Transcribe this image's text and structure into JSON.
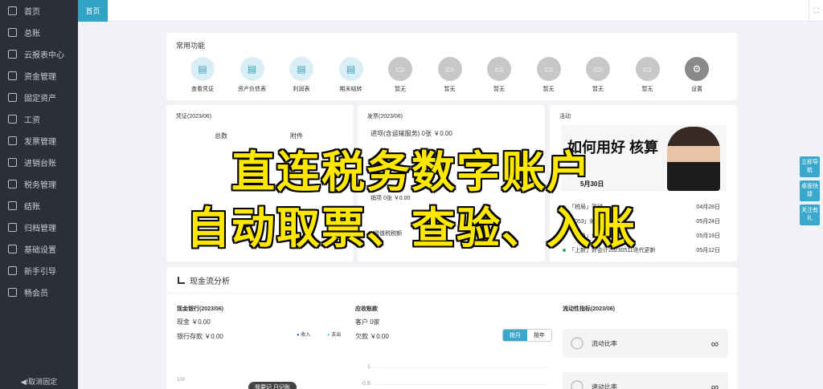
{
  "sidebar": {
    "items": [
      {
        "label": "首页",
        "icon": "home-icon"
      },
      {
        "label": "总账",
        "icon": "ledger-icon"
      },
      {
        "label": "云报表中心",
        "icon": "report-icon"
      },
      {
        "label": "资金管理",
        "icon": "fund-icon"
      },
      {
        "label": "固定资产",
        "icon": "asset-icon"
      },
      {
        "label": "工资",
        "icon": "salary-icon"
      },
      {
        "label": "发票管理",
        "icon": "invoice-icon"
      },
      {
        "label": "进销台账",
        "icon": "inventory-icon"
      },
      {
        "label": "税务管理",
        "icon": "tax-icon"
      },
      {
        "label": "结账",
        "icon": "close-books-icon"
      },
      {
        "label": "归档管理",
        "icon": "archive-icon"
      },
      {
        "label": "基础设置",
        "icon": "settings-icon"
      },
      {
        "label": "新手引导",
        "icon": "guide-icon"
      },
      {
        "label": "畅会员",
        "icon": "vip-icon"
      }
    ],
    "unfix_label": "◀!取消固定"
  },
  "topbar": {
    "home_tab": "首页",
    "fullscreen": "⛶"
  },
  "common": {
    "title": "常用功能",
    "items": [
      {
        "label": "查看凭证",
        "state": "active"
      },
      {
        "label": "资产负债表",
        "state": "active"
      },
      {
        "label": "利润表",
        "state": "active"
      },
      {
        "label": "期末结转",
        "state": "active"
      },
      {
        "label": "暂无",
        "state": "disabled"
      },
      {
        "label": "暂无",
        "state": "disabled"
      },
      {
        "label": "暂无",
        "state": "disabled"
      },
      {
        "label": "暂无",
        "state": "disabled"
      },
      {
        "label": "暂无",
        "state": "disabled"
      },
      {
        "label": "暂无",
        "state": "disabled"
      },
      {
        "label": "设置",
        "state": "settings"
      }
    ]
  },
  "voucher": {
    "title": "凭证(2023/06)",
    "total_label": "总数",
    "attach_label": "附件"
  },
  "invoice": {
    "title": "发票(2023/06)",
    "input_line": "进项(含运输服务) 0张 ￥0.00",
    "sales_line": "销项   0张   ￥0.00",
    "vat_label": "增值税税额",
    "amount": "0.00"
  },
  "activity": {
    "title": "活动",
    "banner_title": "如何用好 核算",
    "banner_date": "5月30日",
    "news": [
      {
        "text": "「税局」答疑",
        "date": "04月28日"
      },
      {
        "text": "「053」如何用",
        "date": "05月24日"
      },
      {
        "text": "「用户」如何用友",
        "date": "05月19日"
      },
      {
        "text": "「上新」好会计20230511迭代更新",
        "date": "05月12日"
      }
    ]
  },
  "float_buttons": [
    "立即导航",
    "桌面快捷",
    "关注有礼"
  ],
  "overlay": {
    "line1": "直连税务数字账户",
    "line2": "自动取票、查验、入账"
  },
  "cashflow": {
    "title": "现金流分析",
    "bank": {
      "title": "现金银行(2023/06)",
      "cash": "现金  ￥0.00",
      "deposit": "银行存款  ￥0.00",
      "legend_in": "收入",
      "legend_out": "支出",
      "tick": "100"
    },
    "receivable": {
      "title": "应收账款",
      "customers": "客户  0家",
      "owed": "欠款  ￥0.00",
      "toggle_month": "按月",
      "toggle_year": "按年",
      "y1": "1",
      "y2": "0.8"
    },
    "liquidity": {
      "title": "流动性指标(2023/06)",
      "ratio1": "流动比率",
      "ratio2": "速动比率",
      "value": "∞"
    },
    "bookkeeping_btn": "我要记  日记账"
  },
  "colors": {
    "accent": "#2fa4c5",
    "sidebar": "#2b2f3a",
    "overlay": "#ffe800"
  }
}
